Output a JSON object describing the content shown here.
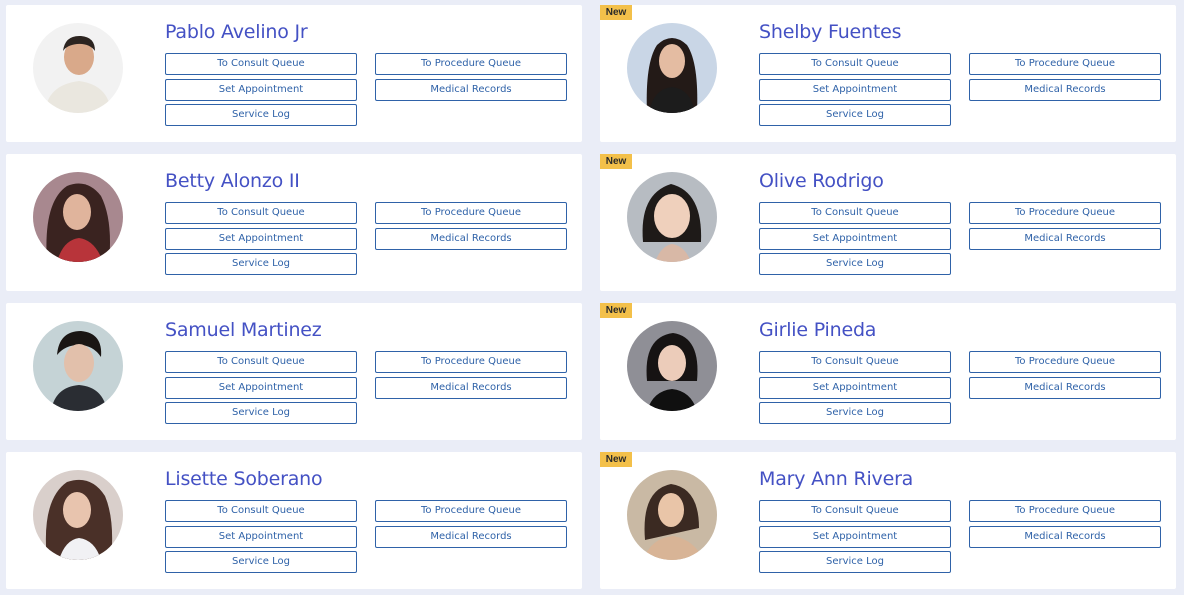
{
  "buttons": {
    "consult": "To Consult Queue",
    "procedure": "To Procedure Queue",
    "appointment": "Set Appointment",
    "records": "Medical Records",
    "service": "Service Log"
  },
  "badge_label": "New",
  "colors": {
    "name": "#4451c4",
    "button": "#2f62a8",
    "badge": "#f3c04a",
    "background": "#eaedf7"
  },
  "patients": [
    {
      "name": "Pablo Avelino Jr",
      "new": false
    },
    {
      "name": "Shelby Fuentes",
      "new": true
    },
    {
      "name": "Betty Alonzo II",
      "new": false
    },
    {
      "name": "Olive Rodrigo",
      "new": true
    },
    {
      "name": "Samuel Martinez",
      "new": false
    },
    {
      "name": "Girlie Pineda",
      "new": true
    },
    {
      "name": "Lisette Soberano",
      "new": false
    },
    {
      "name": "Mary Ann Rivera",
      "new": true
    }
  ]
}
